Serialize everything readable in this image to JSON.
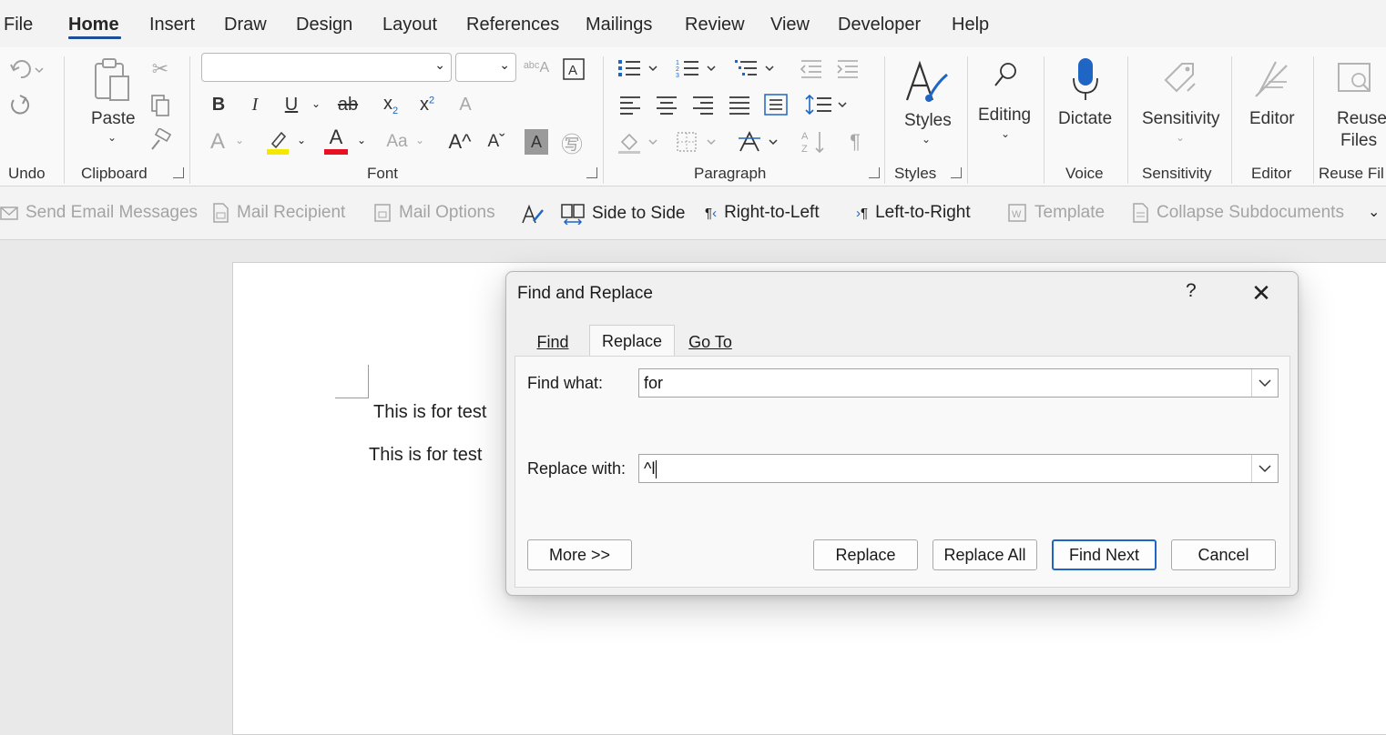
{
  "menu": {
    "items": [
      "File",
      "Home",
      "Insert",
      "Draw",
      "Design",
      "Layout",
      "References",
      "Mailings",
      "Review",
      "View",
      "Developer",
      "Help"
    ],
    "active": "Home"
  },
  "ribbon": {
    "groups": {
      "undo": "Undo",
      "clipboard": "Clipboard",
      "font": "Font",
      "paragraph": "Paragraph",
      "styles": "Styles",
      "voice": "Voice",
      "sensitivity": "Sensitivity",
      "editor": "Editor",
      "reuse": "Reuse Fil"
    },
    "paste_label": "Paste",
    "styles_label": "Styles",
    "editing_label": "Editing",
    "dictate_label": "Dictate",
    "sensitivity_label": "Sensitivity",
    "editor_label": "Editor",
    "reuse_label_1": "Reuse",
    "reuse_label_2": "Files",
    "bold": "B",
    "italic": "I",
    "underline": "U",
    "strike": "ab",
    "font_color_letter": "A",
    "change_case": "Aa",
    "pilcrow": "¶",
    "highlight_color": "#f5e800",
    "font_color": "#e81123"
  },
  "qat": {
    "send_email": "Send Email Messages",
    "mail_recipient": "Mail Recipient",
    "mail_options": "Mail Options",
    "side_to_side": "Side to Side",
    "rtl": "Right-to-Left",
    "ltr": "Left-to-Right",
    "template": "Template",
    "collapse": "Collapse Subdocuments"
  },
  "document": {
    "line1": "This is for test",
    "line2": "This is for test"
  },
  "dialog": {
    "title": "Find and Replace",
    "help": "?",
    "close": "✕",
    "tabs": {
      "find": "Find",
      "replace": "Replace",
      "goto": "Go To"
    },
    "find_label": "Find what:",
    "find_value": "for",
    "replace_label": "Replace with:",
    "replace_value": "^l",
    "buttons": {
      "more": "More >>",
      "replace": "Replace",
      "replace_all": "Replace All",
      "find_next": "Find Next",
      "cancel": "Cancel"
    }
  }
}
